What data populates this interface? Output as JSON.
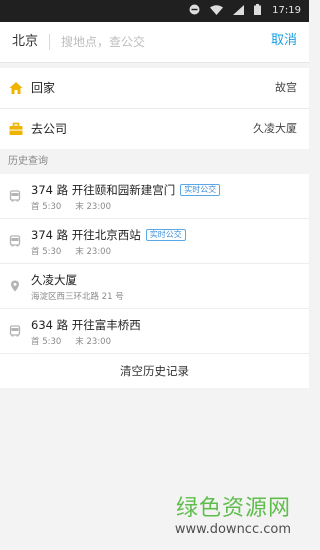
{
  "status_bar": {
    "time": "17:19",
    "icons": [
      "minus-circle-icon",
      "wifi-icon",
      "signal-icon",
      "battery-icon"
    ]
  },
  "search": {
    "city": "北京",
    "placeholder": "搜地点，查公交",
    "value": "",
    "cancel_label": "取消"
  },
  "quick": {
    "home": {
      "label": "回家",
      "value": "故宫"
    },
    "work": {
      "label": "去公司",
      "value": "久凌大厦"
    }
  },
  "history": {
    "header": "历史查询",
    "items": [
      {
        "type": "bus",
        "title": "374 路  开往颐和园新建宫门",
        "badge": "实时公交",
        "first": "首 5:30",
        "last": "末 23:00"
      },
      {
        "type": "bus",
        "title": "374 路  开往北京西站",
        "badge": "实时公交",
        "first": "首 5:30",
        "last": "末 23:00"
      },
      {
        "type": "place",
        "title": "久凌大厦",
        "address": "海淀区西三环北路 21 号"
      },
      {
        "type": "bus",
        "title": "634 路  开往富丰桥西",
        "first": "首 5:30",
        "last": "末 23:00"
      }
    ],
    "clear_label": "清空历史记录"
  },
  "watermark": {
    "cn": "绿色资源网",
    "en": "www.downcc.com"
  },
  "colors": {
    "accent": "#1a9ee6",
    "icon_orange": "#f0b400",
    "status_bar": "#202020",
    "watermark_green": "#4fb83a"
  }
}
